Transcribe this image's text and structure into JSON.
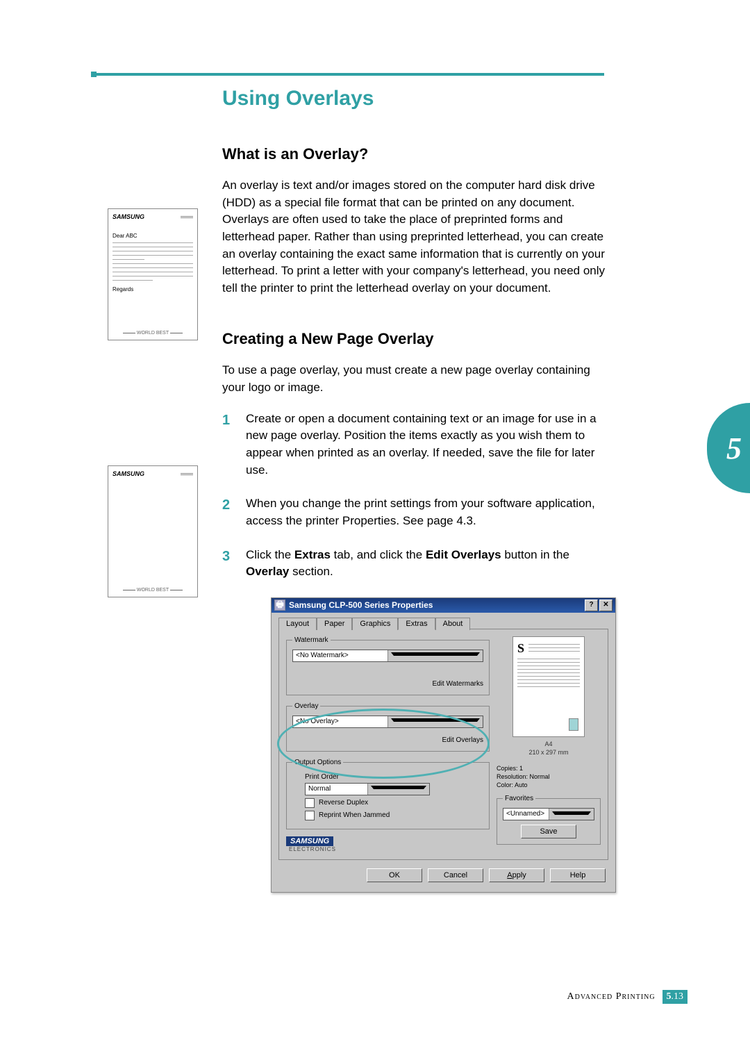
{
  "headings": {
    "h1": "Using Overlays",
    "h2a": "What is an Overlay?",
    "h2b": "Creating a New Page Overlay"
  },
  "paragraphs": {
    "p1": "An overlay is text and/or images stored on the computer hard disk drive (HDD) as a special file format that can be printed on any document. Overlays are often used to take the place of preprinted forms and letterhead paper. Rather than using preprinted letterhead, you can create an overlay containing the exact same information that is currently on your letterhead. To print a letter with your company's letterhead, you need only tell the printer to print the letterhead overlay on your document.",
    "p2": "To use a page overlay, you must create a new page overlay containing your logo or image."
  },
  "steps": {
    "s1": "Create or open a document containing text or an image for use in a new page overlay. Position the items exactly as you wish them to appear when printed as an overlay. If needed, save the file for later use.",
    "s2": "When you change the print settings from your software application, access the printer Properties. See page 4.3.",
    "s3_prefix": "Click the ",
    "s3_b1": "Extras",
    "s3_mid1": " tab, and click the ",
    "s3_b2": "Edit Overlays",
    "s3_mid2": " button in the ",
    "s3_b3": "Overlay",
    "s3_suffix": " section."
  },
  "illus": {
    "brand": "SAMSUNG",
    "salutation": "Dear ABC",
    "regards": "Regards",
    "footer": "WORLD BEST"
  },
  "dialog": {
    "title": "Samsung CLP-500 Series Properties",
    "help_btn": "?",
    "close_btn": "✕",
    "tabs": {
      "layout": "Layout",
      "paper": "Paper",
      "graphics": "Graphics",
      "extras": "Extras",
      "about": "About"
    },
    "watermark_legend": "Watermark",
    "watermark_value": "<No Watermark>",
    "edit_watermarks": "Edit Watermarks",
    "overlay_legend": "Overlay",
    "overlay_value": "<No Overlay>",
    "edit_overlays": "Edit Overlays",
    "output_legend": "Output Options",
    "print_order_label": "Print Order",
    "print_order_value": "Normal",
    "reverse_duplex": "Reverse Duplex",
    "reprint_jammed": "Reprint When Jammed",
    "preview_paper": "A4",
    "preview_dims": "210 x 297 mm",
    "copies": "Copies: 1",
    "resolution": "Resolution: Normal",
    "color": "Color: Auto",
    "favorites_legend": "Favorites",
    "favorites_value": "<Unnamed>",
    "save_btn": "Save",
    "brand": "SAMSUNG",
    "brand_sub": "ELECTRONICS",
    "ok": "OK",
    "cancel": "Cancel",
    "apply": "Apply",
    "help": "Help"
  },
  "chapter_tab": "5",
  "footer": {
    "section": "Advanced Printing",
    "chapter": "5",
    "page": ".13"
  }
}
